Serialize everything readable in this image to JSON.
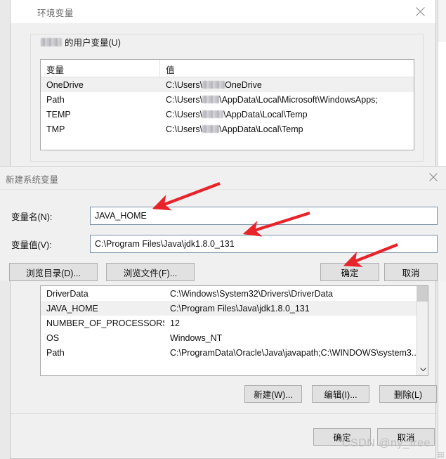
{
  "window": {
    "title": "环境变量",
    "close_icon": "close-icon"
  },
  "user_section": {
    "legend_suffix": "的用户变量(U)",
    "columns": [
      "变量",
      "值"
    ],
    "rows": [
      {
        "name": "OneDrive",
        "value_prefix": "C:\\Users\\",
        "value_suffix": "OneDrive",
        "redacted": true,
        "selected": true
      },
      {
        "name": "Path",
        "value_prefix": "C:\\Users\\",
        "value_suffix": "\\AppData\\Local\\Microsoft\\WindowsApps;",
        "redacted": true,
        "selected": false
      },
      {
        "name": "TEMP",
        "value_prefix": "C:\\Users\\",
        "value_suffix": "\\AppData\\Local\\Temp",
        "redacted": true,
        "selected": false
      },
      {
        "name": "TMP",
        "value_prefix": "C:\\Users\\",
        "value_suffix": "\\AppData\\Local\\Temp",
        "redacted": true,
        "selected": false
      }
    ]
  },
  "system_section": {
    "rows": [
      {
        "name": "DriverData",
        "value": "C:\\Windows\\System32\\Drivers\\DriverData",
        "selected": false
      },
      {
        "name": "JAVA_HOME",
        "value": "C:\\Program Files\\Java\\jdk1.8.0_131",
        "selected": true
      },
      {
        "name": "NUMBER_OF_PROCESSORS",
        "value": "12",
        "selected": false
      },
      {
        "name": "OS",
        "value": "Windows_NT",
        "selected": false
      },
      {
        "name": "Path",
        "value": "C:\\ProgramData\\Oracle\\Java\\javapath;C:\\WINDOWS\\system3...",
        "selected": false
      }
    ],
    "scroll_down_icon": "chevron-down-icon"
  },
  "edit_buttons": {
    "new": "新建(W)...",
    "edit": "编辑(I)...",
    "delete": "删除(L)"
  },
  "main_buttons": {
    "ok": "确定",
    "cancel": "取消"
  },
  "new_variable_dialog": {
    "title": "新建系统变量",
    "close_icon": "close-icon",
    "name_label": "变量名(N):",
    "name_value": "JAVA_HOME",
    "value_label": "变量值(V):",
    "value_value": "C:\\Program Files\\Java\\jdk1.8.0_131",
    "browse_dir": "浏览目录(D)...",
    "browse_file": "浏览文件(F)...",
    "ok": "确定",
    "cancel": "取消"
  },
  "annotations": {
    "markers": [
      "1",
      "2",
      "3"
    ],
    "color": "#e8232a"
  },
  "watermark": {
    "text": "CSDN @ny_free"
  }
}
